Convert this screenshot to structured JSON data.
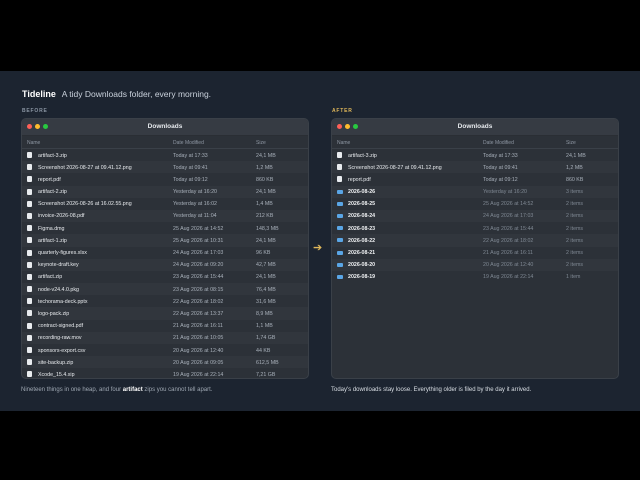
{
  "brand": {
    "name": "Tideline",
    "tagline": "A tidy Downloads folder, every morning."
  },
  "labels": {
    "before": "BEFORE",
    "after": "AFTER"
  },
  "columns": {
    "name": "Name",
    "date": "Date Modified",
    "size": "Size"
  },
  "window_title": "Downloads",
  "before_rows": [
    {
      "name": "artifact-3.zip",
      "date": "Today at 17:33",
      "size": "24,1 MB"
    },
    {
      "name": "Screenshot 2026-08-27 at 09.41.12.png",
      "date": "Today at 09:41",
      "size": "1,2 MB"
    },
    {
      "name": "report.pdf",
      "date": "Today at 09:12",
      "size": "860 KB"
    },
    {
      "name": "artifact-2.zip",
      "date": "Yesterday at 16:20",
      "size": "24,1 MB"
    },
    {
      "name": "Screenshot 2026-08-26 at 16.02.55.png",
      "date": "Yesterday at 16:02",
      "size": "1,4 MB"
    },
    {
      "name": "invoice-2026-08.pdf",
      "date": "Yesterday at 11:04",
      "size": "212 KB"
    },
    {
      "name": "Figma.dmg",
      "date": "25 Aug 2026 at 14:52",
      "size": "148,3 MB"
    },
    {
      "name": "artifact-1.zip",
      "date": "25 Aug 2026 at 10:31",
      "size": "24,1 MB"
    },
    {
      "name": "quarterly-figures.xlsx",
      "date": "24 Aug 2026 at 17:03",
      "size": "96 KB"
    },
    {
      "name": "keynote-draft.key",
      "date": "24 Aug 2026 at 09:20",
      "size": "42,7 MB"
    },
    {
      "name": "artifact.zip",
      "date": "23 Aug 2026 at 15:44",
      "size": "24,1 MB"
    },
    {
      "name": "node-v24.4.0.pkg",
      "date": "23 Aug 2026 at 08:15",
      "size": "76,4 MB"
    },
    {
      "name": "techorama-deck.pptx",
      "date": "22 Aug 2026 at 18:02",
      "size": "31,6 MB"
    },
    {
      "name": "logo-pack.zip",
      "date": "22 Aug 2026 at 13:37",
      "size": "8,9 MB"
    },
    {
      "name": "contract-signed.pdf",
      "date": "21 Aug 2026 at 16:11",
      "size": "1,1 MB"
    },
    {
      "name": "recording-raw.mov",
      "date": "21 Aug 2026 at 10:05",
      "size": "1,74 GB"
    },
    {
      "name": "sponsors-export.csv",
      "date": "20 Aug 2026 at 12:40",
      "size": "44 KB"
    },
    {
      "name": "site-backup.zip",
      "date": "20 Aug 2026 at 09:05",
      "size": "612,5 MB"
    },
    {
      "name": "Xcode_15.4.xip",
      "date": "19 Aug 2026 at 22:14",
      "size": "7,21 GB"
    }
  ],
  "after_files": [
    {
      "name": "artifact-3.zip",
      "date": "Today at 17:33",
      "size": "24,1 MB"
    },
    {
      "name": "Screenshot 2026-08-27 at 09.41.12.png",
      "date": "Today at 09:41",
      "size": "1,2 MB"
    },
    {
      "name": "report.pdf",
      "date": "Today at 09:12",
      "size": "860 KB"
    }
  ],
  "after_folders": [
    {
      "name": "2026-08-26",
      "date": "Yesterday at 16:20",
      "size": "3 items"
    },
    {
      "name": "2026-08-25",
      "date": "25 Aug 2026 at 14:52",
      "size": "2 items"
    },
    {
      "name": "2026-08-24",
      "date": "24 Aug 2026 at 17:03",
      "size": "2 items"
    },
    {
      "name": "2026-08-23",
      "date": "23 Aug 2026 at 15:44",
      "size": "2 items"
    },
    {
      "name": "2026-08-22",
      "date": "22 Aug 2026 at 18:02",
      "size": "2 items"
    },
    {
      "name": "2026-08-21",
      "date": "21 Aug 2026 at 16:11",
      "size": "2 items"
    },
    {
      "name": "2026-08-20",
      "date": "20 Aug 2026 at 12:40",
      "size": "2 items"
    },
    {
      "name": "2026-08-19",
      "date": "19 Aug 2026 at 22:14",
      "size": "1 item"
    }
  ],
  "captions": {
    "left_pre": "Nineteen things in one heap, and four ",
    "left_bold": "artifact",
    "left_post": " zips you cannot tell apart.",
    "right": "Today's downloads stay loose. Everything older is filed by the day it arrived."
  },
  "colors": {
    "accent": "#e0b85a",
    "folder": "#5aa6e6",
    "background": "#1c2430"
  },
  "icons": {
    "file": "file-icon",
    "folder": "folder-icon",
    "arrow": "arrow-right-icon"
  }
}
